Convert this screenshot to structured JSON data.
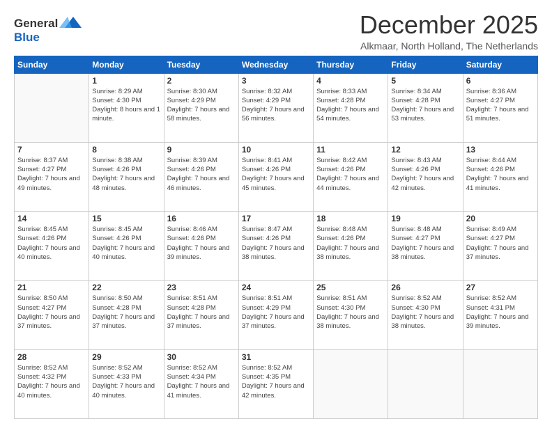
{
  "header": {
    "logo_line1": "General",
    "logo_line2": "Blue",
    "month": "December 2025",
    "location": "Alkmaar, North Holland, The Netherlands"
  },
  "weekdays": [
    "Sunday",
    "Monday",
    "Tuesday",
    "Wednesday",
    "Thursday",
    "Friday",
    "Saturday"
  ],
  "weeks": [
    [
      {
        "day": "",
        "sunrise": "",
        "sunset": "",
        "daylight": ""
      },
      {
        "day": "1",
        "sunrise": "Sunrise: 8:29 AM",
        "sunset": "Sunset: 4:30 PM",
        "daylight": "Daylight: 8 hours and 1 minute."
      },
      {
        "day": "2",
        "sunrise": "Sunrise: 8:30 AM",
        "sunset": "Sunset: 4:29 PM",
        "daylight": "Daylight: 7 hours and 58 minutes."
      },
      {
        "day": "3",
        "sunrise": "Sunrise: 8:32 AM",
        "sunset": "Sunset: 4:29 PM",
        "daylight": "Daylight: 7 hours and 56 minutes."
      },
      {
        "day": "4",
        "sunrise": "Sunrise: 8:33 AM",
        "sunset": "Sunset: 4:28 PM",
        "daylight": "Daylight: 7 hours and 54 minutes."
      },
      {
        "day": "5",
        "sunrise": "Sunrise: 8:34 AM",
        "sunset": "Sunset: 4:28 PM",
        "daylight": "Daylight: 7 hours and 53 minutes."
      },
      {
        "day": "6",
        "sunrise": "Sunrise: 8:36 AM",
        "sunset": "Sunset: 4:27 PM",
        "daylight": "Daylight: 7 hours and 51 minutes."
      }
    ],
    [
      {
        "day": "7",
        "sunrise": "Sunrise: 8:37 AM",
        "sunset": "Sunset: 4:27 PM",
        "daylight": "Daylight: 7 hours and 49 minutes."
      },
      {
        "day": "8",
        "sunrise": "Sunrise: 8:38 AM",
        "sunset": "Sunset: 4:26 PM",
        "daylight": "Daylight: 7 hours and 48 minutes."
      },
      {
        "day": "9",
        "sunrise": "Sunrise: 8:39 AM",
        "sunset": "Sunset: 4:26 PM",
        "daylight": "Daylight: 7 hours and 46 minutes."
      },
      {
        "day": "10",
        "sunrise": "Sunrise: 8:41 AM",
        "sunset": "Sunset: 4:26 PM",
        "daylight": "Daylight: 7 hours and 45 minutes."
      },
      {
        "day": "11",
        "sunrise": "Sunrise: 8:42 AM",
        "sunset": "Sunset: 4:26 PM",
        "daylight": "Daylight: 7 hours and 44 minutes."
      },
      {
        "day": "12",
        "sunrise": "Sunrise: 8:43 AM",
        "sunset": "Sunset: 4:26 PM",
        "daylight": "Daylight: 7 hours and 42 minutes."
      },
      {
        "day": "13",
        "sunrise": "Sunrise: 8:44 AM",
        "sunset": "Sunset: 4:26 PM",
        "daylight": "Daylight: 7 hours and 41 minutes."
      }
    ],
    [
      {
        "day": "14",
        "sunrise": "Sunrise: 8:45 AM",
        "sunset": "Sunset: 4:26 PM",
        "daylight": "Daylight: 7 hours and 40 minutes."
      },
      {
        "day": "15",
        "sunrise": "Sunrise: 8:45 AM",
        "sunset": "Sunset: 4:26 PM",
        "daylight": "Daylight: 7 hours and 40 minutes."
      },
      {
        "day": "16",
        "sunrise": "Sunrise: 8:46 AM",
        "sunset": "Sunset: 4:26 PM",
        "daylight": "Daylight: 7 hours and 39 minutes."
      },
      {
        "day": "17",
        "sunrise": "Sunrise: 8:47 AM",
        "sunset": "Sunset: 4:26 PM",
        "daylight": "Daylight: 7 hours and 38 minutes."
      },
      {
        "day": "18",
        "sunrise": "Sunrise: 8:48 AM",
        "sunset": "Sunset: 4:26 PM",
        "daylight": "Daylight: 7 hours and 38 minutes."
      },
      {
        "day": "19",
        "sunrise": "Sunrise: 8:48 AM",
        "sunset": "Sunset: 4:27 PM",
        "daylight": "Daylight: 7 hours and 38 minutes."
      },
      {
        "day": "20",
        "sunrise": "Sunrise: 8:49 AM",
        "sunset": "Sunset: 4:27 PM",
        "daylight": "Daylight: 7 hours and 37 minutes."
      }
    ],
    [
      {
        "day": "21",
        "sunrise": "Sunrise: 8:50 AM",
        "sunset": "Sunset: 4:27 PM",
        "daylight": "Daylight: 7 hours and 37 minutes."
      },
      {
        "day": "22",
        "sunrise": "Sunrise: 8:50 AM",
        "sunset": "Sunset: 4:28 PM",
        "daylight": "Daylight: 7 hours and 37 minutes."
      },
      {
        "day": "23",
        "sunrise": "Sunrise: 8:51 AM",
        "sunset": "Sunset: 4:28 PM",
        "daylight": "Daylight: 7 hours and 37 minutes."
      },
      {
        "day": "24",
        "sunrise": "Sunrise: 8:51 AM",
        "sunset": "Sunset: 4:29 PM",
        "daylight": "Daylight: 7 hours and 37 minutes."
      },
      {
        "day": "25",
        "sunrise": "Sunrise: 8:51 AM",
        "sunset": "Sunset: 4:30 PM",
        "daylight": "Daylight: 7 hours and 38 minutes."
      },
      {
        "day": "26",
        "sunrise": "Sunrise: 8:52 AM",
        "sunset": "Sunset: 4:30 PM",
        "daylight": "Daylight: 7 hours and 38 minutes."
      },
      {
        "day": "27",
        "sunrise": "Sunrise: 8:52 AM",
        "sunset": "Sunset: 4:31 PM",
        "daylight": "Daylight: 7 hours and 39 minutes."
      }
    ],
    [
      {
        "day": "28",
        "sunrise": "Sunrise: 8:52 AM",
        "sunset": "Sunset: 4:32 PM",
        "daylight": "Daylight: 7 hours and 40 minutes."
      },
      {
        "day": "29",
        "sunrise": "Sunrise: 8:52 AM",
        "sunset": "Sunset: 4:33 PM",
        "daylight": "Daylight: 7 hours and 40 minutes."
      },
      {
        "day": "30",
        "sunrise": "Sunrise: 8:52 AM",
        "sunset": "Sunset: 4:34 PM",
        "daylight": "Daylight: 7 hours and 41 minutes."
      },
      {
        "day": "31",
        "sunrise": "Sunrise: 8:52 AM",
        "sunset": "Sunset: 4:35 PM",
        "daylight": "Daylight: 7 hours and 42 minutes."
      },
      {
        "day": "",
        "sunrise": "",
        "sunset": "",
        "daylight": ""
      },
      {
        "day": "",
        "sunrise": "",
        "sunset": "",
        "daylight": ""
      },
      {
        "day": "",
        "sunrise": "",
        "sunset": "",
        "daylight": ""
      }
    ]
  ]
}
